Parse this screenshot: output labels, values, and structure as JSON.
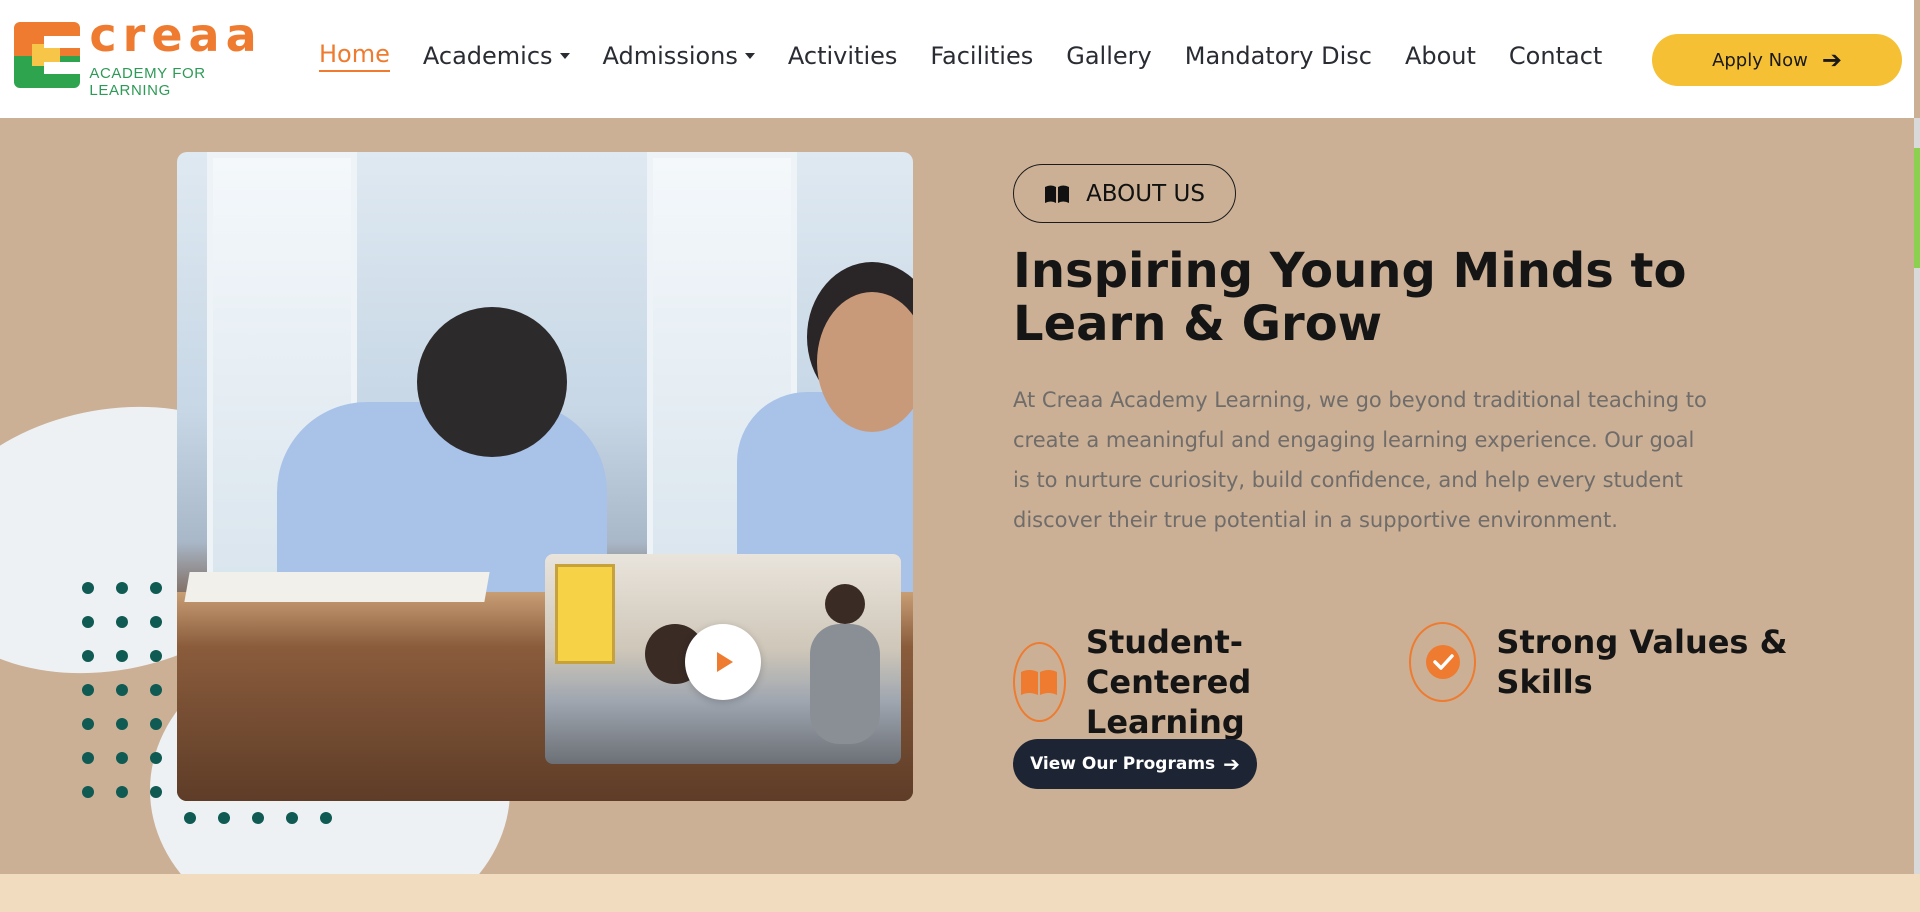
{
  "brand": {
    "name": "creaa",
    "tagline": "ACADEMY FOR LEARNING",
    "colors": {
      "orange": "#ee7b2f",
      "green": "#2ea44f",
      "yellow": "#f7c548"
    }
  },
  "nav": {
    "items": [
      {
        "label": "Home",
        "active": true,
        "dropdown": false
      },
      {
        "label": "Academics",
        "active": false,
        "dropdown": true
      },
      {
        "label": "Admissions",
        "active": false,
        "dropdown": true
      },
      {
        "label": "Activities",
        "active": false,
        "dropdown": false
      },
      {
        "label": "Facilities",
        "active": false,
        "dropdown": false
      },
      {
        "label": "Gallery",
        "active": false,
        "dropdown": false
      },
      {
        "label": "Mandatory Disc",
        "active": false,
        "dropdown": false
      },
      {
        "label": "About",
        "active": false,
        "dropdown": false
      },
      {
        "label": "Contact",
        "active": false,
        "dropdown": false
      }
    ]
  },
  "header": {
    "apply_label": "Apply Now",
    "apply_icon": "arrow-right-icon"
  },
  "about": {
    "pill_label": "ABOUT US",
    "pill_icon": "open-book-icon",
    "headline": "Inspiring Young Minds to Learn & Grow",
    "paragraph": "At Creaa Academy Learning, we go beyond traditional teaching to create a meaningful and engaging learning experience. Our goal is to nurture curiosity, build confidence, and help every student discover their true potential in a supportive environment.",
    "features": [
      {
        "label": "Student-Centered Learning",
        "icon": "open-book-icon"
      },
      {
        "label": "Strong Values & Skills",
        "icon": "check-circle-icon"
      }
    ],
    "cta_label": "View Our Programs",
    "cta_icon": "arrow-right-icon"
  },
  "media": {
    "play_icon": "play-icon"
  },
  "colors": {
    "background": "#cbb096",
    "accent": "#ee7b2f",
    "button_yellow": "#f5c033",
    "button_dark": "#1d2434",
    "dots": "#0f5a52"
  }
}
